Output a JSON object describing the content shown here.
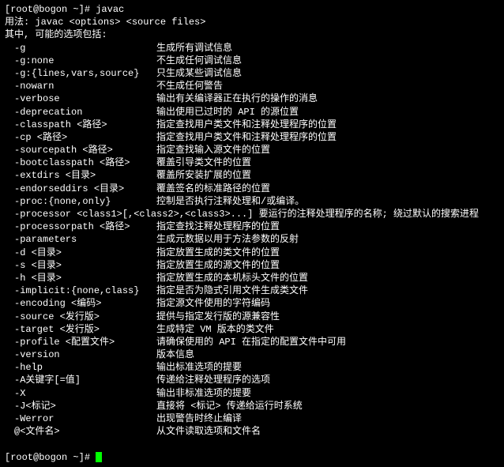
{
  "prompt_line": "[root@bogon ~]# javac",
  "usage": "用法: javac <options> <source files>",
  "intro": "其中, 可能的选项包括:",
  "options": [
    {
      "opt": "-g",
      "desc": "生成所有调试信息"
    },
    {
      "opt": "-g:none",
      "desc": "不生成任何调试信息"
    },
    {
      "opt": "-g:{lines,vars,source}",
      "desc": "只生成某些调试信息"
    },
    {
      "opt": "-nowarn",
      "desc": "不生成任何警告"
    },
    {
      "opt": "-verbose",
      "desc": "输出有关编译器正在执行的操作的消息"
    },
    {
      "opt": "-deprecation",
      "desc": "输出使用已过时的 API 的源位置"
    },
    {
      "opt": "-classpath <路径>",
      "desc": "指定查找用户类文件和注释处理程序的位置"
    },
    {
      "opt": "-cp <路径>",
      "desc": "指定查找用户类文件和注释处理程序的位置"
    },
    {
      "opt": "-sourcepath <路径>",
      "desc": "指定查找输入源文件的位置"
    },
    {
      "opt": "-bootclasspath <路径>",
      "desc": "覆盖引导类文件的位置"
    },
    {
      "opt": "-extdirs <目录>",
      "desc": "覆盖所安装扩展的位置"
    },
    {
      "opt": "-endorseddirs <目录>",
      "desc": "覆盖签名的标准路径的位置"
    },
    {
      "opt": "-proc:{none,only}",
      "desc": "控制是否执行注释处理和/或编译。"
    },
    {
      "opt": "-processor <class1>[,<class2>,<class3>...] 要运行的注释处理程序的名称; 绕过默认的搜索进程",
      "desc": ""
    },
    {
      "opt": "-processorpath <路径>",
      "desc": "指定查找注释处理程序的位置"
    },
    {
      "opt": "-parameters",
      "desc": "生成元数据以用于方法参数的反射"
    },
    {
      "opt": "-d <目录>",
      "desc": "指定放置生成的类文件的位置"
    },
    {
      "opt": "-s <目录>",
      "desc": "指定放置生成的源文件的位置"
    },
    {
      "opt": "-h <目录>",
      "desc": "指定放置生成的本机标头文件的位置"
    },
    {
      "opt": "-implicit:{none,class}",
      "desc": "指定是否为隐式引用文件生成类文件"
    },
    {
      "opt": "-encoding <编码>",
      "desc": "指定源文件使用的字符编码"
    },
    {
      "opt": "-source <发行版>",
      "desc": "提供与指定发行版的源兼容性"
    },
    {
      "opt": "-target <发行版>",
      "desc": "生成特定 VM 版本的类文件"
    },
    {
      "opt": "-profile <配置文件>",
      "desc": "请确保使用的 API 在指定的配置文件中可用"
    },
    {
      "opt": "-version",
      "desc": "版本信息"
    },
    {
      "opt": "-help",
      "desc": "输出标准选项的提要"
    },
    {
      "opt": "-A关键字[=值]",
      "desc": "传递给注释处理程序的选项"
    },
    {
      "opt": "-X",
      "desc": "输出非标准选项的提要"
    },
    {
      "opt": "-J<标记>",
      "desc": "直接将 <标记> 传递给运行时系统"
    },
    {
      "opt": "-Werror",
      "desc": "出现警告时终止编译"
    },
    {
      "opt": "@<文件名>",
      "desc": "从文件读取选项和文件名"
    }
  ],
  "prompt_end": "[root@bogon ~]# "
}
